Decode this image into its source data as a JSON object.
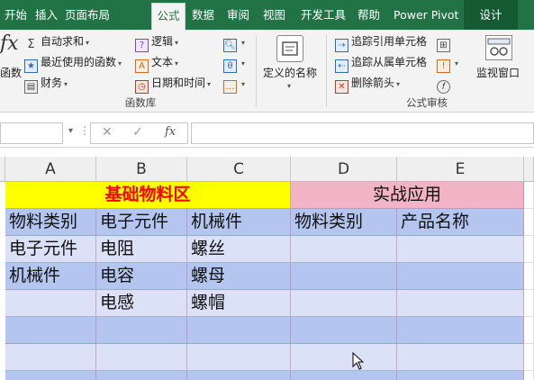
{
  "tabs": {
    "items": [
      "开始",
      "插入",
      "页面布局",
      "公式",
      "数据",
      "审阅",
      "视图",
      "开发工具",
      "帮助",
      "Power Pivot",
      "设计"
    ],
    "active": "公式"
  },
  "ribbon": {
    "insert_function_label": "函数",
    "function_library": {
      "autosum": "自动求和",
      "recent": "最近使用的函数",
      "financial": "财务",
      "logical": "逻辑",
      "text": "文本",
      "datetime": "日期和时间",
      "group_label": "函数库"
    },
    "defined_names": {
      "label": "定义的名称"
    },
    "formula_auditing": {
      "trace_precedents": "追踪引用单元格",
      "trace_dependents": "追踪从属单元格",
      "remove_arrows": "删除箭头",
      "group_label": "公式审核"
    },
    "watch_window": "监视窗口"
  },
  "formula_bar": {
    "cancel_icon": "close-icon",
    "enter_icon": "check-icon",
    "fx_label": "fx",
    "value": ""
  },
  "grid": {
    "columns": [
      "A",
      "B",
      "C",
      "D",
      "E"
    ],
    "header_left": "基础物料区",
    "header_right": "实战应用",
    "subheader": [
      "物料类别",
      "电子元件",
      "机械件",
      "物料类别",
      "产品名称"
    ],
    "rows": [
      [
        "电子元件",
        "电阻",
        "螺丝",
        "",
        ""
      ],
      [
        "机械件",
        "电容",
        "螺母",
        "",
        ""
      ],
      [
        "",
        "电感",
        "螺帽",
        "",
        ""
      ],
      [
        "",
        "",
        "",
        "",
        ""
      ],
      [
        "",
        "",
        "",
        "",
        ""
      ],
      [
        "",
        "",
        "",
        "",
        ""
      ]
    ]
  },
  "colors": {
    "ribbon_green": "#217346",
    "header_yellow": "#ffff00",
    "header_red_text": "#ff0000",
    "header_pink": "#f2b3c6",
    "band_blue": "#b4c6f0",
    "band_light": "#dbe1f7"
  }
}
